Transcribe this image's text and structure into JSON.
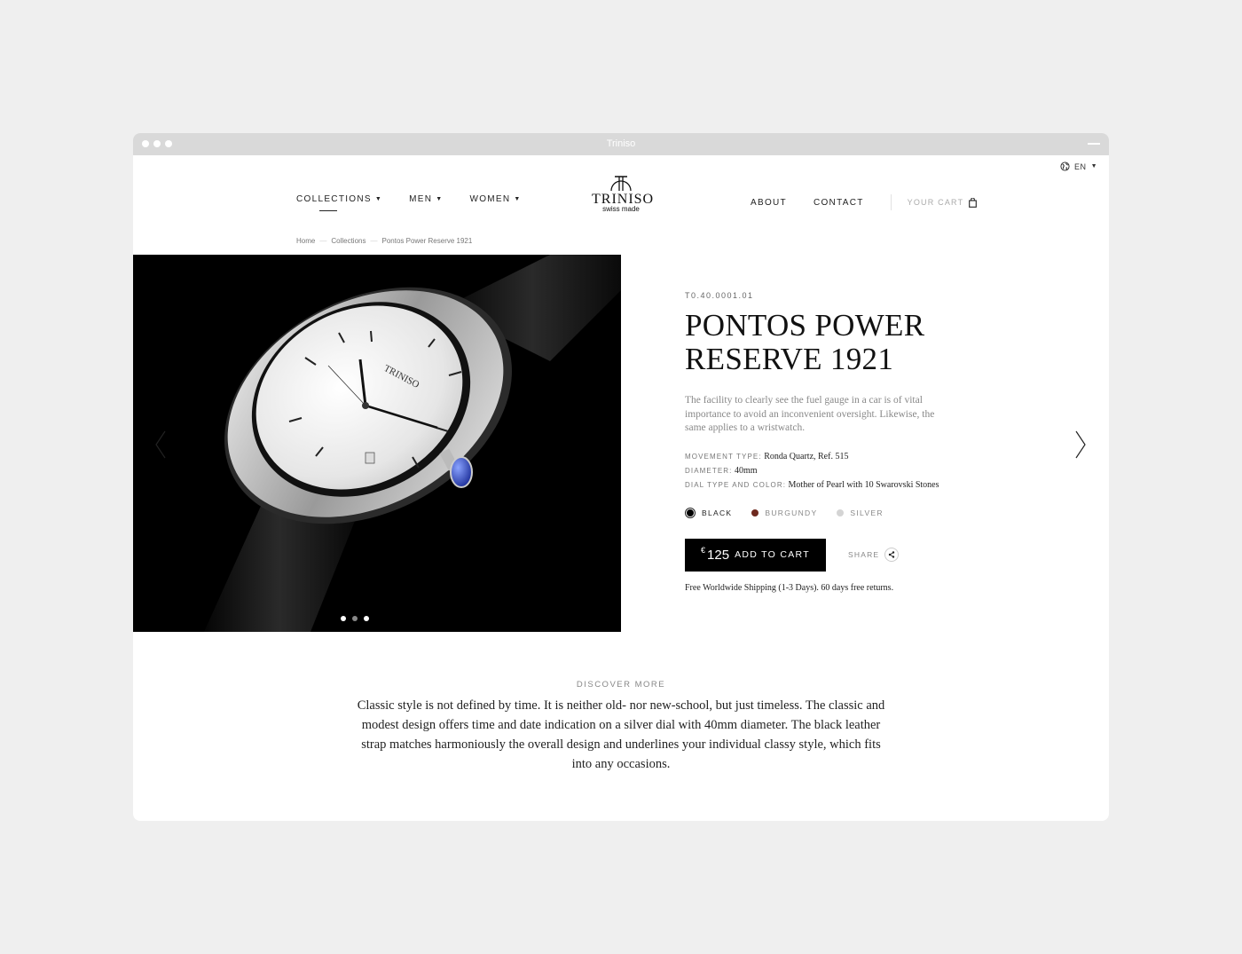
{
  "window": {
    "title": "Triniso"
  },
  "lang": {
    "label": "EN"
  },
  "nav": {
    "left": [
      {
        "label": "COLLECTIONS"
      },
      {
        "label": "MEN"
      },
      {
        "label": "WOMEN"
      }
    ],
    "right": [
      {
        "label": "ABOUT"
      },
      {
        "label": "CONTACT"
      }
    ],
    "cart_label": "YOUR CART"
  },
  "logo": {
    "name": "TRINISO",
    "tagline": "swiss made"
  },
  "breadcrumb": [
    "Home",
    "Collections",
    "Pontos Power Reserve 1921"
  ],
  "hero": {
    "dial_brand": "TRINISO",
    "slides": 3,
    "active_slide": 0
  },
  "product": {
    "sku": "T0.40.0001.01",
    "title_line1": "PONTOS POWER",
    "title_line2": "RESERVE 1921",
    "description": "The facility to clearly see the fuel gauge in a car is of vital importance to avoid an inconvenient oversight. Likewise, the same applies to a wristwatch.",
    "specs": [
      {
        "label": "MOVEMENT TYPE:",
        "value": "Ronda Quartz, Ref. 515"
      },
      {
        "label": "DIAMETER:",
        "value": "40mm"
      },
      {
        "label": "DIAL TYPE AND COLOR:",
        "value": "Mother of Pearl with 10 Swarovski Stones"
      }
    ],
    "colors": [
      {
        "label": "BLACK",
        "hex": "#000000",
        "selected": true
      },
      {
        "label": "BURGUNDY",
        "hex": "#6e2a1f",
        "selected": false
      },
      {
        "label": "SILVER",
        "hex": "#d4d4d4",
        "selected": false
      }
    ],
    "currency": "€",
    "price": "125",
    "add_label": "ADD TO CART",
    "share_label": "SHARE",
    "shipping": "Free Worldwide Shipping (1-3 Days). 60 days free returns."
  },
  "discover": {
    "label": "DISCOVER MORE",
    "text": "Classic style is not defined by time. It is neither old- nor new-school, but just timeless. The classic and modest design offers time and date indication on a silver dial with 40mm diameter. The black leather strap matches harmoniously the overall design and underlines your individual classy style, which fits into any occasions."
  }
}
